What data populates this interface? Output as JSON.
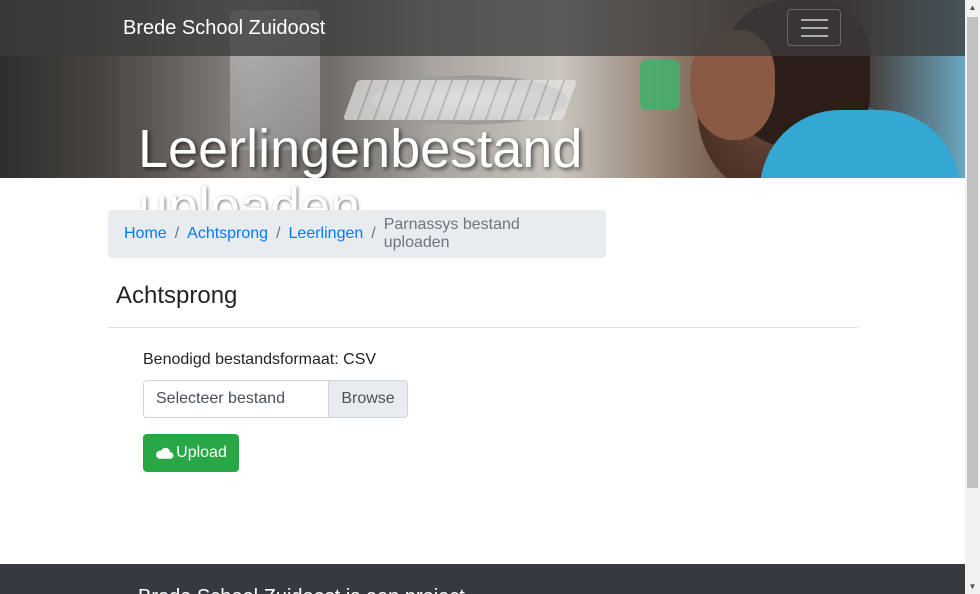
{
  "navbar": {
    "brand": "Brede School Zuidoost"
  },
  "hero": {
    "title": "Leerlingenbestand uploaden"
  },
  "breadcrumb": {
    "items": [
      "Home",
      "Achtsprong",
      "Leerlingen"
    ],
    "separator": "/",
    "active": "Parnassys bestand uploaden"
  },
  "main": {
    "section_title": "Achtsprong",
    "format_label": "Benodigd bestandsformaat: CSV",
    "file_placeholder": "Selecteer bestand",
    "browse_label": "Browse",
    "upload_label": "Upload",
    "upload_icon": "cloud-upload-icon"
  },
  "footer": {
    "text": "Brede School Zuidoost is een project"
  },
  "colors": {
    "navbar_bg": "#3c3c3c",
    "link": "#007bff",
    "success": "#28a745",
    "footer_bg": "#343a40",
    "breadcrumb_bg": "#e9ecef"
  }
}
